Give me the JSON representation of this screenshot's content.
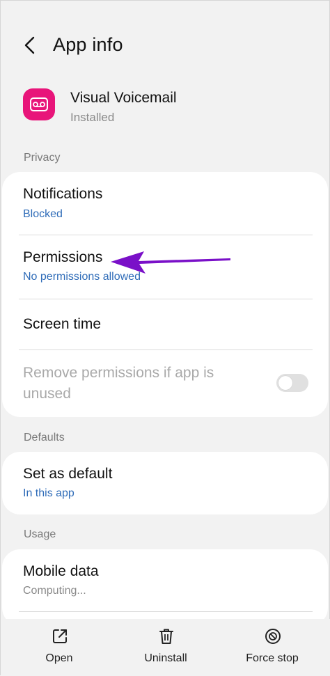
{
  "header": {
    "title": "App info"
  },
  "app": {
    "name": "Visual Voicemail",
    "status": "Installed",
    "icon_color": "#e8157a"
  },
  "privacy": {
    "section_label": "Privacy",
    "notifications": {
      "title": "Notifications",
      "sub": "Blocked"
    },
    "permissions": {
      "title": "Permissions",
      "sub": "No permissions allowed"
    },
    "screen_time": {
      "title": "Screen time"
    },
    "remove_permissions": {
      "title": "Remove permissions if app is unused",
      "enabled": false
    }
  },
  "defaults": {
    "section_label": "Defaults",
    "set_as_default": {
      "title": "Set as default",
      "sub": "In this app"
    }
  },
  "usage": {
    "section_label": "Usage",
    "mobile_data": {
      "title": "Mobile data",
      "sub": "Computing..."
    }
  },
  "bottom_bar": {
    "open_label": "Open",
    "uninstall_label": "Uninstall",
    "force_stop_label": "Force stop"
  },
  "colors": {
    "link_blue": "#2f6cb8",
    "annotation_arrow": "#7a10c8"
  },
  "icons": [
    "back-arrow-icon",
    "voicemail-icon",
    "open-external-icon",
    "trash-icon",
    "stop-icon"
  ]
}
